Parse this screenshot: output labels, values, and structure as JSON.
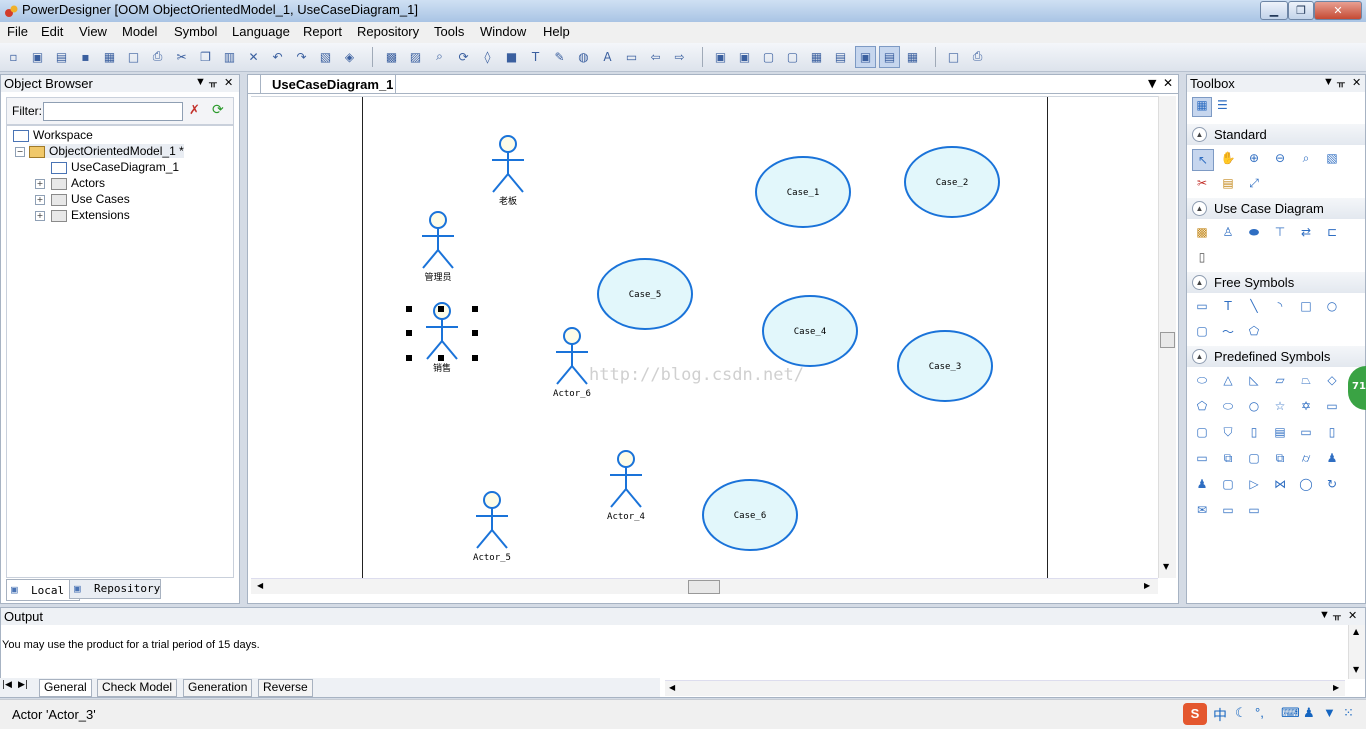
{
  "window": {
    "title": "PowerDesigner [OOM ObjectOrientedModel_1, UseCaseDiagram_1]",
    "minimize": "▁",
    "restore": "❐",
    "close": "✕"
  },
  "menu": [
    "File",
    "Edit",
    "View",
    "Model",
    "Symbol",
    "Language",
    "Report",
    "Repository",
    "Tools",
    "Window",
    "Help"
  ],
  "object_browser": {
    "title": "Object Browser",
    "filter_label": "Filter:",
    "filter_value": "",
    "tree": {
      "workspace": "Workspace",
      "model": "ObjectOrientedModel_1 *",
      "diagram": "UseCaseDiagram_1",
      "folders": [
        "Actors",
        "Use Cases",
        "Extensions"
      ]
    },
    "tabs": [
      "Local",
      "Repository"
    ]
  },
  "document": {
    "tab": "UseCaseDiagram_1",
    "watermark": "http://blog.csdn.net/",
    "actors": [
      {
        "label": "老板"
      },
      {
        "label": "管理员"
      },
      {
        "label": "销售"
      },
      {
        "label": "Actor_6"
      },
      {
        "label": "Actor_4"
      },
      {
        "label": "Actor_5"
      }
    ],
    "use_cases": [
      {
        "label": "Case_1"
      },
      {
        "label": "Case_2"
      },
      {
        "label": "Case_5"
      },
      {
        "label": "Case_4"
      },
      {
        "label": "Case_3"
      },
      {
        "label": "Case_6"
      }
    ],
    "colors": {
      "actor": "#1a73d9",
      "case_fill": "#e2f7fb",
      "case_stroke": "#1a73d9"
    }
  },
  "toolbox": {
    "title": "Toolbox",
    "sections": [
      "Standard",
      "Use Case Diagram",
      "Free Symbols",
      "Predefined Symbols"
    ]
  },
  "output": {
    "title": "Output",
    "message": "You may use the product for a trial period of 15 days.",
    "tabs": [
      "General",
      "Check Model",
      "Generation",
      "Reverse"
    ]
  },
  "status": {
    "text": "Actor 'Actor_3'"
  },
  "badge": "71"
}
